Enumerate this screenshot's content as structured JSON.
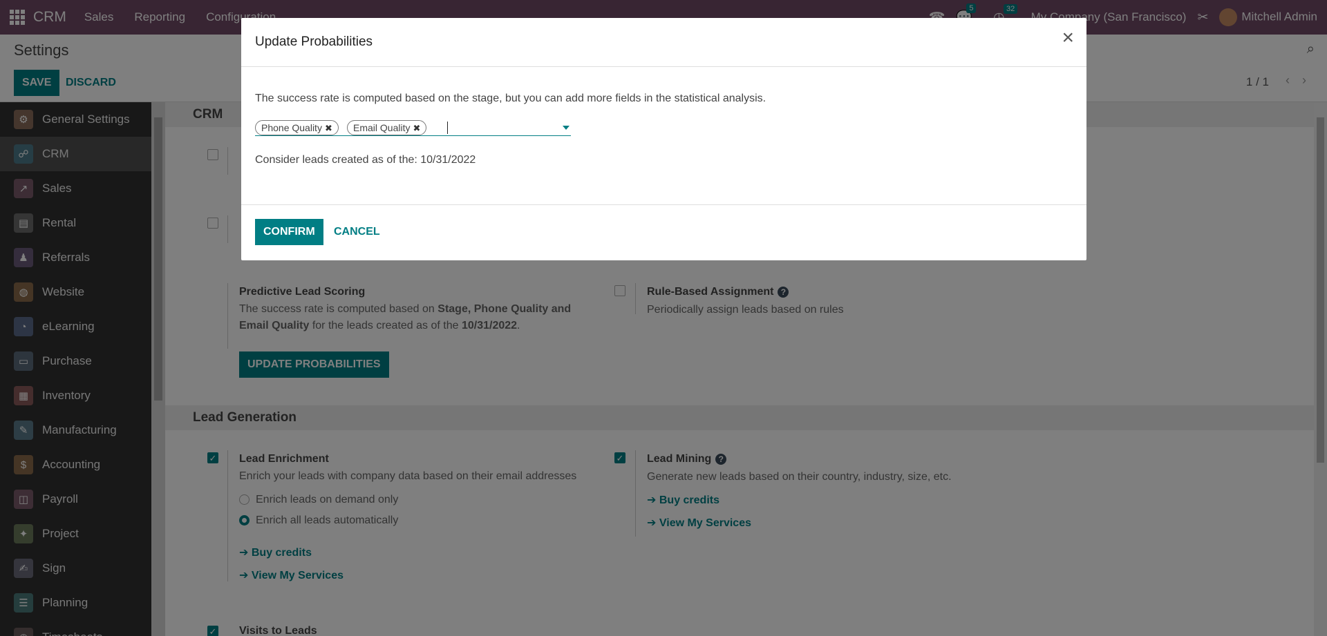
{
  "topnav": {
    "brand": "CRM",
    "menus": [
      "Sales",
      "Reporting",
      "Configuration"
    ],
    "messages_count": "5",
    "activities_count": "32",
    "company": "My Company (San Francisco)",
    "user": "Mitchell Admin"
  },
  "control_panel": {
    "title": "Settings",
    "save_label": "SAVE",
    "discard_label": "DISCARD",
    "pager": "1 / 1"
  },
  "sidebar": {
    "items": [
      {
        "label": "General Settings",
        "color": "#8a6d5a",
        "icon": "⚙"
      },
      {
        "label": "CRM",
        "color": "#4c7a8a",
        "icon": "☍"
      },
      {
        "label": "Sales",
        "color": "#7a5a6a",
        "icon": "↗"
      },
      {
        "label": "Rental",
        "color": "#6a6a6a",
        "icon": "▤"
      },
      {
        "label": "Referrals",
        "color": "#6a5a7a",
        "icon": "♟"
      },
      {
        "label": "Website",
        "color": "#8a6a4a",
        "icon": "◍"
      },
      {
        "label": "eLearning",
        "color": "#5a6a8a",
        "icon": "◔"
      },
      {
        "label": "Purchase",
        "color": "#5a6a7a",
        "icon": "▭"
      },
      {
        "label": "Inventory",
        "color": "#8a5a5a",
        "icon": "▦"
      },
      {
        "label": "Manufacturing",
        "color": "#5a7a8a",
        "icon": "✎"
      },
      {
        "label": "Accounting",
        "color": "#8a6a4a",
        "icon": "$"
      },
      {
        "label": "Payroll",
        "color": "#7a5a6a",
        "icon": "◫"
      },
      {
        "label": "Project",
        "color": "#6a7a5a",
        "icon": "✦"
      },
      {
        "label": "Sign",
        "color": "#6a6a7a",
        "icon": "✍"
      },
      {
        "label": "Planning",
        "color": "#4a7a7a",
        "icon": "☰"
      },
      {
        "label": "Timesheets",
        "color": "#6a5a5a",
        "icon": "◷"
      }
    ]
  },
  "content": {
    "crm_section": "CRM",
    "pls_title": "Predictive Lead Scoring",
    "pls_desc_1": "The success rate is computed based on ",
    "pls_desc_bold_1": "Stage, Phone Quality and",
    "pls_desc_bold_2": "Email Quality",
    "pls_desc_2": " for the leads created as of the ",
    "pls_desc_date": "10/31/2022",
    "pls_desc_end": ".",
    "update_button": "UPDATE PROBABILITIES",
    "rba_title": "Rule-Based Assignment",
    "rba_desc": "Periodically assign leads based on rules",
    "lead_gen_section": "Lead Generation",
    "enrich_title": "Lead Enrichment",
    "enrich_desc": "Enrich your leads with company data based on their email addresses",
    "enrich_opt1": "Enrich leads on demand only",
    "enrich_opt2": "Enrich all leads automatically",
    "buy_credits": "Buy credits",
    "view_services": "View My Services",
    "mining_title": "Lead Mining",
    "mining_desc": "Generate new leads based on their country, industry, size, etc.",
    "visits_title": "Visits to Leads"
  },
  "modal": {
    "title": "Update Probabilities",
    "description": "The success rate is computed based on the stage, but you can add more fields in the statistical analysis.",
    "tags": [
      "Phone Quality",
      "Email Quality"
    ],
    "consider_label": "Consider leads created as of the: ",
    "consider_date": "10/31/2022",
    "confirm_label": "CONFIRM",
    "cancel_label": "CANCEL"
  },
  "colors": {
    "brand_purple": "#714b67",
    "accent_teal": "#017e84"
  }
}
